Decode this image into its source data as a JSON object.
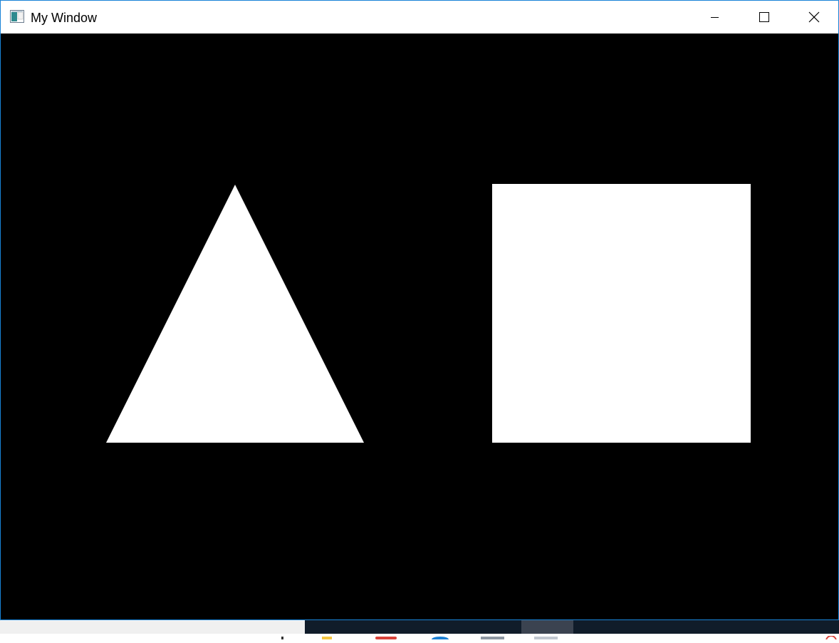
{
  "window": {
    "title": "My Window",
    "icon": "app-window-icon",
    "controls": {
      "minimize": "minimize-icon",
      "maximize": "maximize-icon",
      "close": "close-icon"
    }
  },
  "canvas": {
    "background_color": "#000000",
    "shapes": [
      {
        "type": "triangle",
        "fill": "#ffffff"
      },
      {
        "type": "square",
        "fill": "#ffffff"
      }
    ]
  },
  "taskbar": {
    "icons": [
      "file-explorer-icon",
      "app-red-icon",
      "edge-browser-icon",
      "app-window-icon",
      "app-window-active-icon",
      "app-red-edge-icon"
    ]
  }
}
